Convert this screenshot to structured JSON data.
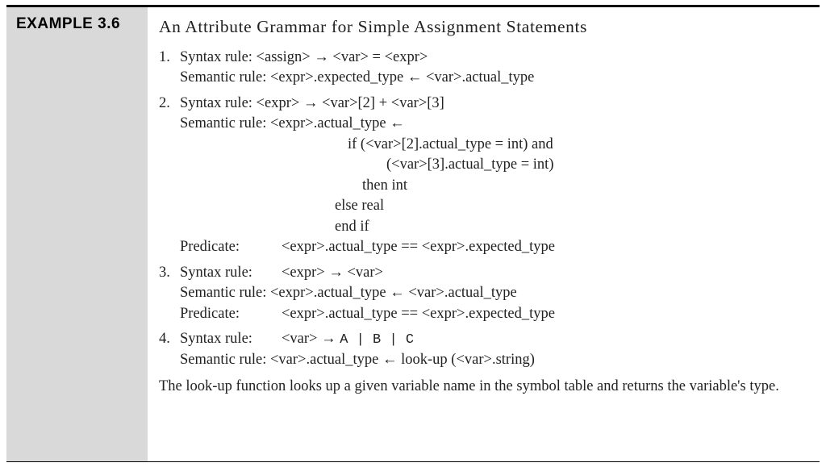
{
  "example": {
    "label": "EXAMPLE 3.6",
    "title": "An Attribute Grammar for Simple Assignment Statements",
    "rules": [
      {
        "num": "1.",
        "syntax_label": "Syntax rule:",
        "syntax_body": "<assign> → <var>  =  <expr>",
        "semantic_label": "Semantic rule:",
        "semantic_body": "<expr>.expected_type ← <var>.actual_type"
      },
      {
        "num": "2.",
        "syntax_label": "Syntax rule:",
        "syntax_body": "<expr> → <var>[2]  +  <var>[3]",
        "semantic_label": "Semantic rule:",
        "semantic_body_start": "<expr>.actual_type ←",
        "if_line": "if  (<var>[2].actual_type = int)  and",
        "paren2_line": "(<var>[3].actual_type = int)",
        "then_line": "then int",
        "else_line": "else real",
        "endif_line": "end if",
        "predicate_label": "Predicate:",
        "predicate_body": "<expr>.actual_type == <expr>.expected_type"
      },
      {
        "num": "3.",
        "syntax_label": "Syntax rule:",
        "syntax_body": "<expr> → <var>",
        "semantic_label": "Semantic rule:",
        "semantic_body": "<expr>.actual_type ← <var>.actual_type",
        "predicate_label": "Predicate:",
        "predicate_body": "<expr>.actual_type == <expr>.expected_type"
      },
      {
        "num": "4.",
        "syntax_label": "Syntax rule:",
        "syntax_body_prefix": "<var> → ",
        "syntax_body_mono": "A | B | C",
        "semantic_label": "Semantic rule:",
        "semantic_body": "<var>.actual_type ← look-up (<var>.string)"
      }
    ],
    "footer": "The look-up function looks up a given variable name in the symbol table and returns the variable's type."
  }
}
